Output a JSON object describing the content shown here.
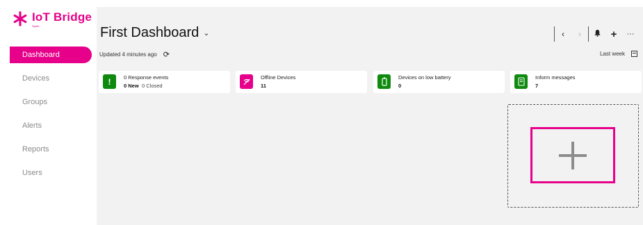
{
  "brand": {
    "name": "IoT Bridge",
    "sub": "Spark",
    "color": "#e6008a"
  },
  "nav": {
    "items": [
      {
        "label": "Dashboard",
        "active": true
      },
      {
        "label": "Devices"
      },
      {
        "label": "Groups"
      },
      {
        "label": "Alerts"
      },
      {
        "label": "Reports"
      },
      {
        "label": "Users"
      }
    ]
  },
  "dashboard": {
    "title": "First Dashboard",
    "updated": "Updated 4 minutes ago",
    "range": "Last week"
  },
  "cards": [
    {
      "label": "0 Response events",
      "value": "0 New",
      "value2": "0 Closed",
      "icon": "exclamation-icon",
      "color": "#0f8a0f"
    },
    {
      "label": "Offline Devices",
      "value": "11",
      "icon": "offline-signal-icon",
      "color": "#e6008a"
    },
    {
      "label": "Devices on low battery",
      "value": "0",
      "icon": "battery-icon",
      "color": "#0f8a0f"
    },
    {
      "label": "Inform messages",
      "value": "7",
      "icon": "message-icon",
      "color": "#0f8a0f"
    }
  ],
  "colors": {
    "accent": "#e6008a",
    "success": "#0f8a0f",
    "panel": "#f2f2f2"
  }
}
